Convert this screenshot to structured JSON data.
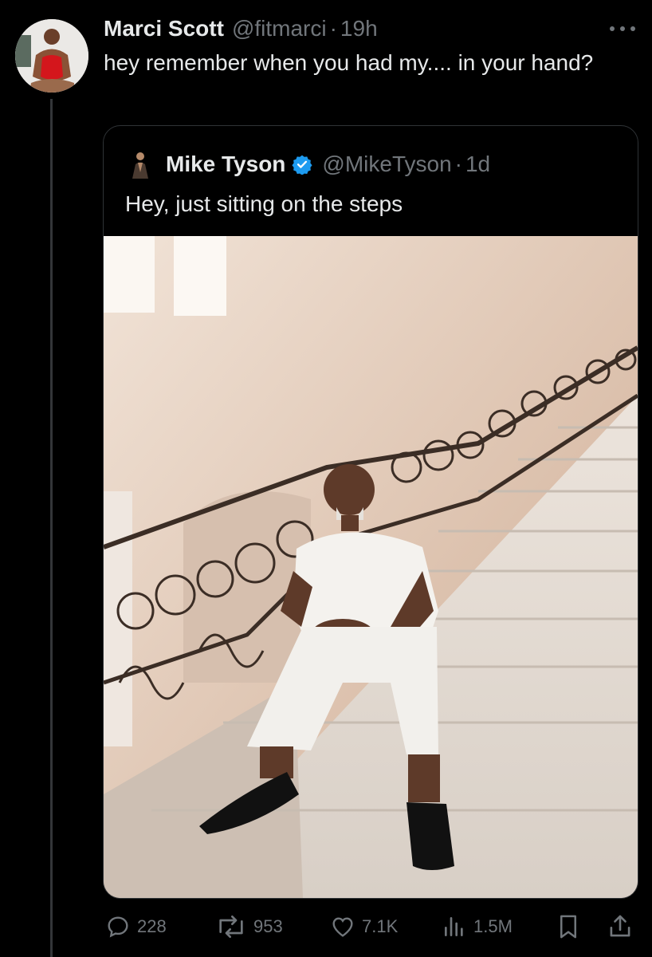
{
  "tweet": {
    "author_name": "Marci Scott",
    "author_handle": "@fitmarci",
    "separator": "·",
    "time": "19h",
    "text": "hey remember when you had my.... in your hand?"
  },
  "quoted_tweet": {
    "author_name": "Mike Tyson",
    "author_handle": "@MikeTyson",
    "separator": "·",
    "time": "1d",
    "verified": true,
    "text": "Hey, just sitting on the steps"
  },
  "actions": {
    "replies": "228",
    "reposts": "953",
    "likes": "7.1K",
    "views": "1.5M"
  },
  "icons": {
    "more": "more-icon",
    "reply": "reply-icon",
    "repost": "repost-icon",
    "like": "heart-icon",
    "views": "views-icon",
    "bookmark": "bookmark-icon",
    "share": "share-icon",
    "verified": "verified-badge-icon"
  },
  "colors": {
    "background": "#000000",
    "text_primary": "#e7e9ea",
    "text_secondary": "#71767b",
    "verified_blue": "#1d9bf0",
    "border": "#2f3336"
  }
}
